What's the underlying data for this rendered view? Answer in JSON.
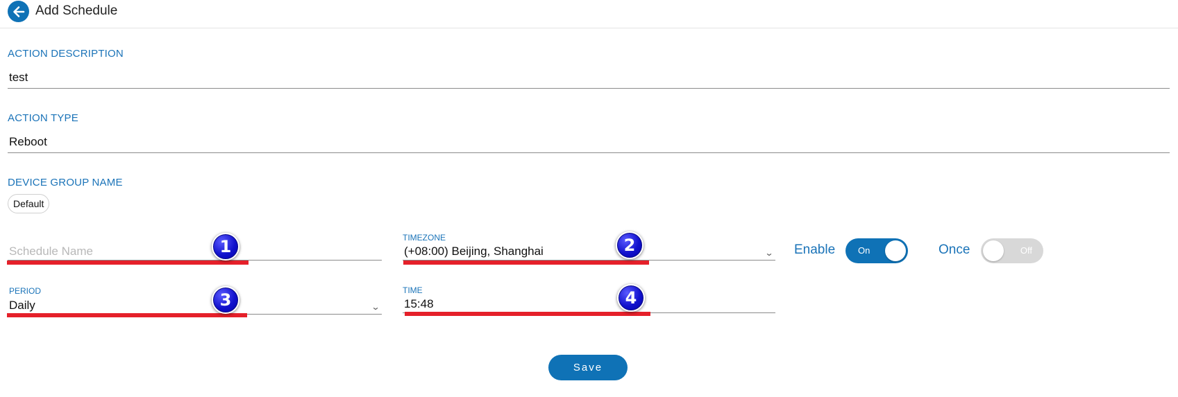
{
  "header": {
    "back_icon": "arrow-left-icon",
    "title": "Add Schedule"
  },
  "form": {
    "action_description": {
      "label": "ACTION DESCRIPTION",
      "value": "test"
    },
    "action_type": {
      "label": "ACTION TYPE",
      "value": "Reboot"
    },
    "device_group": {
      "label": "DEVICE GROUP NAME",
      "chip": "Default"
    },
    "schedule_name": {
      "placeholder": "Schedule Name",
      "value": ""
    },
    "timezone": {
      "label": "TIMEZONE",
      "value": "(+08:00) Beijing, Shanghai"
    },
    "enable": {
      "label": "Enable",
      "state": "On",
      "on": true
    },
    "once": {
      "label": "Once",
      "state": "Off",
      "on": false
    },
    "period": {
      "label": "PERIOD",
      "value": "Daily"
    },
    "time": {
      "label": "TIME",
      "value": "15:48"
    },
    "save_label": "Save"
  },
  "annotations": {
    "badges": [
      "1",
      "2",
      "3",
      "4"
    ],
    "badge_color": "#1111cc",
    "highlight_color": "#e5202a"
  },
  "colors": {
    "accent": "#0f72b6",
    "label": "#1a73b8",
    "toggle_off": "#d8d8d8"
  }
}
